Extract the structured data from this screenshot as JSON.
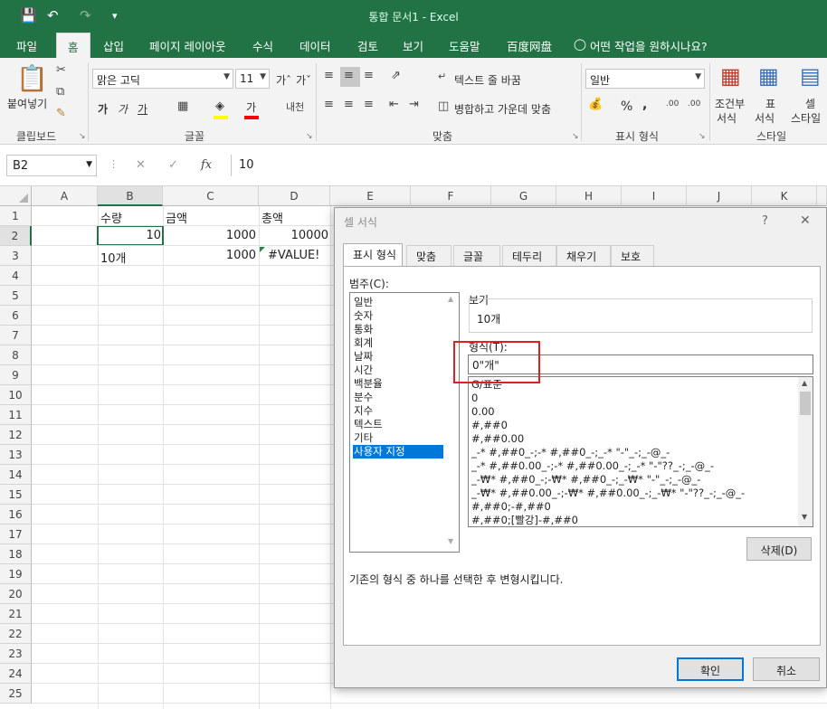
{
  "app": {
    "window_title": "통합 문서1  -  Excel"
  },
  "ribbon_tabs": [
    "파일",
    "홈",
    "삽입",
    "페이지 레이아웃",
    "수식",
    "데이터",
    "검토",
    "보기",
    "도움말",
    "百度网盘"
  ],
  "tell_me": "어떤 작업을 원하시나요?",
  "ribbon": {
    "clipboard": {
      "paste": "붙여넣기",
      "label": "클립보드"
    },
    "font": {
      "name": "맑은 고딕",
      "size": "11",
      "bold": "가",
      "italic": "가",
      "underline": "가",
      "label": "글꼴"
    },
    "align": {
      "wrap": "텍스트 줄 바꿈",
      "merge": "병합하고 가운데 맞춤",
      "label": "맞춤"
    },
    "number": {
      "format": "일반",
      "percent": "%",
      "comma": ",",
      "label": "표시 형식"
    },
    "styles": {
      "cond": "조건부",
      "cond2": "서식",
      "table": "표",
      "table2": "서식",
      "cell": "셀",
      "cell2": "스타일",
      "label": "스타일"
    }
  },
  "formula_bar": {
    "name_box": "B2",
    "formula": "10",
    "fx": "fx"
  },
  "sheet": {
    "columns": [
      "A",
      "B",
      "C",
      "D",
      "E",
      "F",
      "G",
      "H",
      "I",
      "J",
      "K"
    ],
    "rows": [
      "1",
      "2",
      "3",
      "4",
      "5",
      "6",
      "7",
      "8",
      "9",
      "10",
      "11",
      "12",
      "13",
      "14",
      "15",
      "16",
      "17",
      "18",
      "19",
      "20",
      "21",
      "22",
      "23",
      "24",
      "25"
    ],
    "cells": {
      "B1": "수량",
      "C1": "금액",
      "D1": "총액",
      "B2": "10",
      "C2": "1000",
      "D2": "10000",
      "B3": "10개",
      "C3": "1000",
      "D3": "#VALUE!"
    }
  },
  "dialog": {
    "title": "셀 서식",
    "help": "?",
    "close": "✕",
    "tabs": [
      "표시 형식",
      "맞춤",
      "글꼴",
      "테두리",
      "채우기",
      "보호"
    ],
    "category_label": "범주(C):",
    "categories": [
      "일반",
      "숫자",
      "통화",
      "회계",
      "날짜",
      "시간",
      "백분율",
      "분수",
      "지수",
      "텍스트",
      "기타",
      "사용자 지정"
    ],
    "selected_category": "사용자 지정",
    "sample_label": "보기",
    "sample_value": "10개",
    "type_label": "형식(T):",
    "type_value": "0\"개\"",
    "formats": [
      "G/표준",
      "0",
      "0.00",
      "#,##0",
      "#,##0.00",
      "_-* #,##0_-;-* #,##0_-;_-* \"-\"_-;_-@_-",
      "_-* #,##0.00_-;-* #,##0.00_-;_-* \"-\"??_-;_-@_-",
      "_-₩* #,##0_-;-₩* #,##0_-;_-₩* \"-\"_-;_-@_-",
      "_-₩* #,##0.00_-;-₩* #,##0.00_-;_-₩* \"-\"??_-;_-@_-",
      "#,##0;-#,##0",
      "#,##0;[빨강]-#,##0"
    ],
    "delete_button": "삭제(D)",
    "description": "기존의 형식 중 하나를 선택한 후 변형시킵니다.",
    "ok_button": "확인",
    "cancel_button": "취소"
  },
  "colors": {
    "excel_green": "#217346",
    "selection_blue": "#0078d7",
    "highlight_red": "#e02020"
  }
}
